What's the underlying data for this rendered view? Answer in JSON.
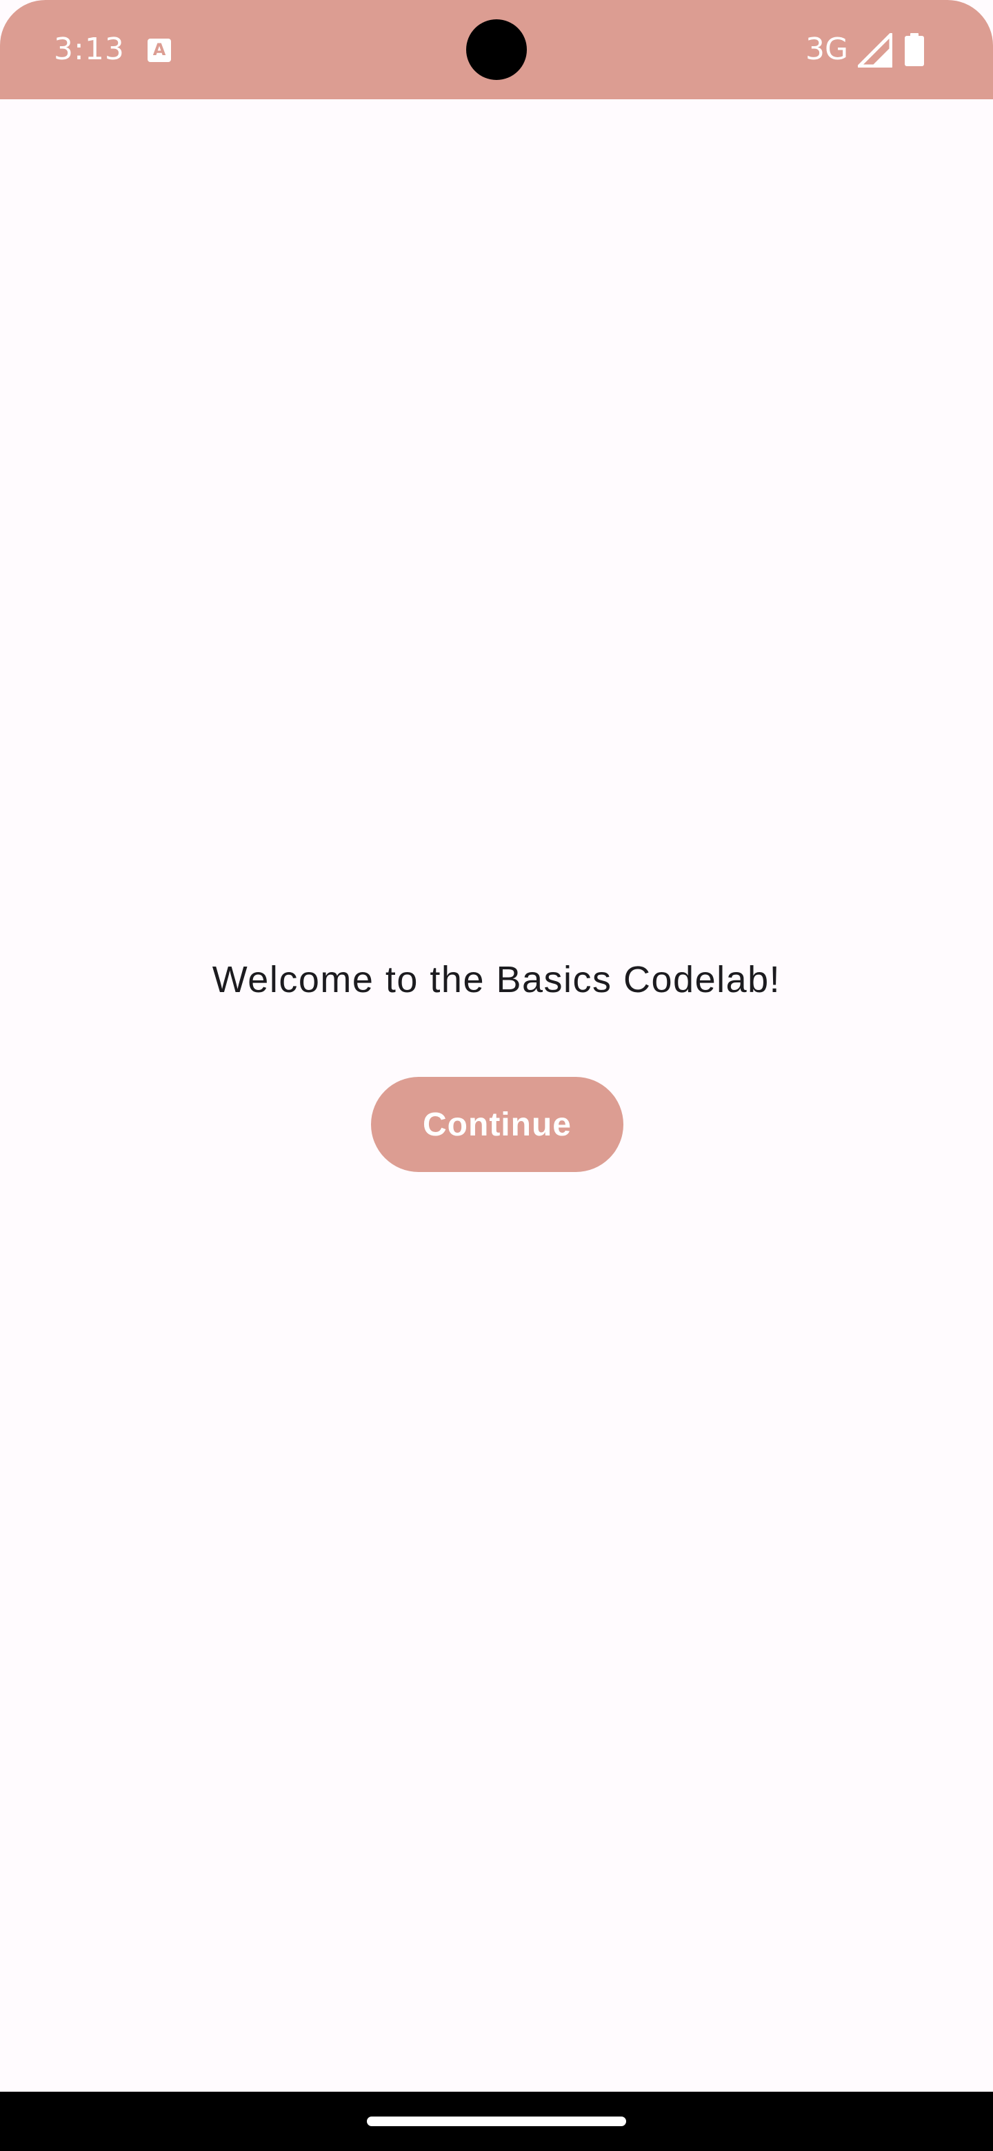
{
  "status_bar": {
    "time": "3:13",
    "notification_icon": "text-a-icon",
    "notification_glyph": "A",
    "network": "3G",
    "signal_icon": "cellular-signal-icon",
    "battery_icon": "battery-full-icon"
  },
  "main": {
    "greeting": "Welcome to the Basics Codelab!",
    "continue_label": "Continue"
  },
  "colors": {
    "accent": "#dc9d92",
    "background": "#fffbfe",
    "text": "#1c1b1f"
  }
}
